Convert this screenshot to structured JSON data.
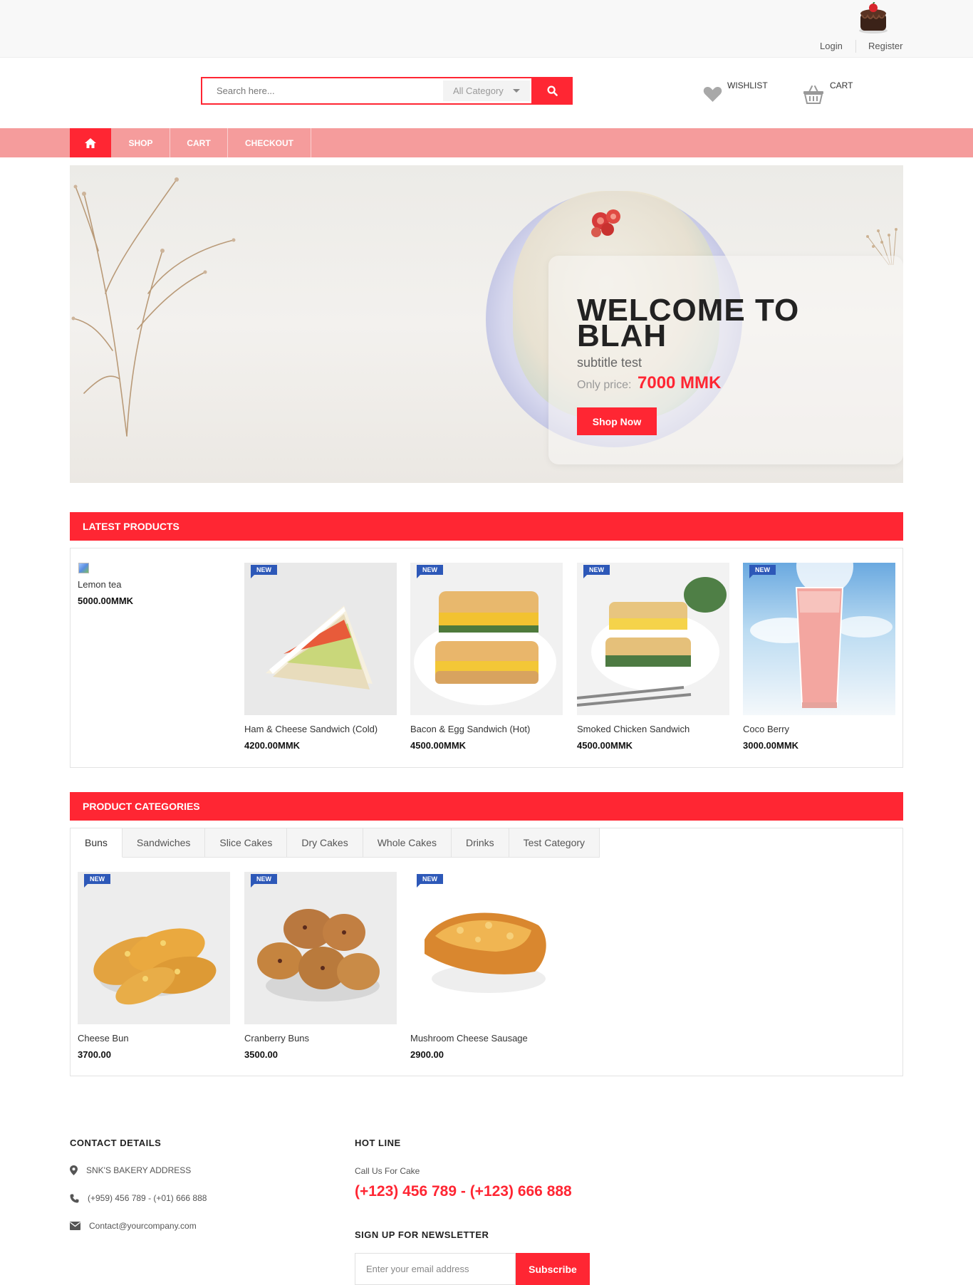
{
  "auth": {
    "login": "Login",
    "register": "Register"
  },
  "search": {
    "placeholder": "Search here...",
    "category": "All Category"
  },
  "header": {
    "wishlist": "WISHLIST",
    "cart": "CART"
  },
  "nav": {
    "shop": "SHOP",
    "cart": "CART",
    "checkout": "CHECKOUT"
  },
  "hero": {
    "title": "WELCOME TO BLAH",
    "subtitle": "subtitle test",
    "price_label": "Only price:",
    "price": "7000 MMK",
    "button": "Shop Now"
  },
  "latest": {
    "heading": "LATEST PRODUCTS",
    "products": [
      {
        "name": "Lemon tea",
        "price": "5000.00MMK",
        "image": "broken"
      },
      {
        "name": "Ham & Cheese Sandwich (Cold)",
        "price": "4200.00MMK",
        "badge": "NEW",
        "image": "sandwich-icon"
      },
      {
        "name": "Bacon & Egg Sandwich (Hot)",
        "price": "4500.00MMK",
        "badge": "NEW",
        "image": "sandwich-icon"
      },
      {
        "name": "Smoked Chicken Sandwich",
        "price": "4500.00MMK",
        "badge": "NEW",
        "image": "sandwich-icon"
      },
      {
        "name": "Coco Berry",
        "price": "3000.00MMK",
        "badge": "NEW",
        "image": "drink-icon"
      }
    ]
  },
  "categories": {
    "heading": "PRODUCT CATEGORIES",
    "tabs": [
      "Buns",
      "Sandwiches",
      "Slice Cakes",
      "Dry Cakes",
      "Whole Cakes",
      "Drinks",
      "Test Category"
    ],
    "active_tab": "Buns",
    "products": [
      {
        "name": "Cheese Bun",
        "price": "3700.00",
        "badge": "NEW",
        "image": "bun-icon"
      },
      {
        "name": "Cranberry Buns",
        "price": "3500.00",
        "badge": "NEW",
        "image": "bun-icon"
      },
      {
        "name": "Mushroom Cheese Sausage",
        "price": "2900.00",
        "badge": "NEW",
        "image": "bread-icon"
      }
    ]
  },
  "footer": {
    "contact_heading": "CONTACT DETAILS",
    "address": "SNK'S BAKERY ADDRESS",
    "phone": "(+959) 456 789 - (+01) 666 888",
    "email": "Contact@yourcompany.com",
    "hotline_heading": "HOT LINE",
    "hotline_sub": "Call Us For Cake",
    "hotline_number": "(+123) 456 789 - (+123) 666 888",
    "newsletter_heading": "SIGN UP FOR NEWSLETTER",
    "newsletter_placeholder": "Enter your email address",
    "newsletter_button": "Subscribe"
  },
  "colors": {
    "accent": "#ff2633",
    "nav_bg": "#f59c9c",
    "badge": "#2d58b8"
  }
}
